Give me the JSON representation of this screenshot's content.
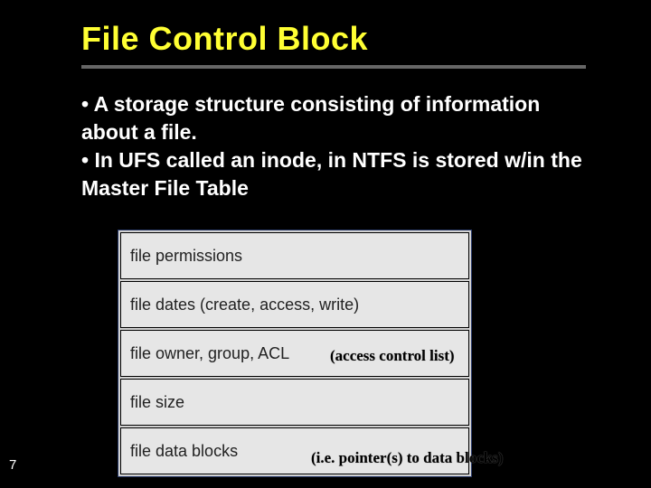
{
  "slide": {
    "title": "File Control Block",
    "page_number": "7"
  },
  "bullets": {
    "b1": "• A storage structure consisting of information about a file.",
    "b2": "• In UFS called an inode, in NTFS is stored w/in the Master File Table"
  },
  "fcb": {
    "r1": "file permissions",
    "r2": "file dates (create, access, write)",
    "r3": "file owner, group, ACL",
    "r4": "file size",
    "r5": "file data blocks"
  },
  "annotations": {
    "acl": "(access control list)",
    "ptr": "(i.e. pointer(s) to data blocks)"
  }
}
